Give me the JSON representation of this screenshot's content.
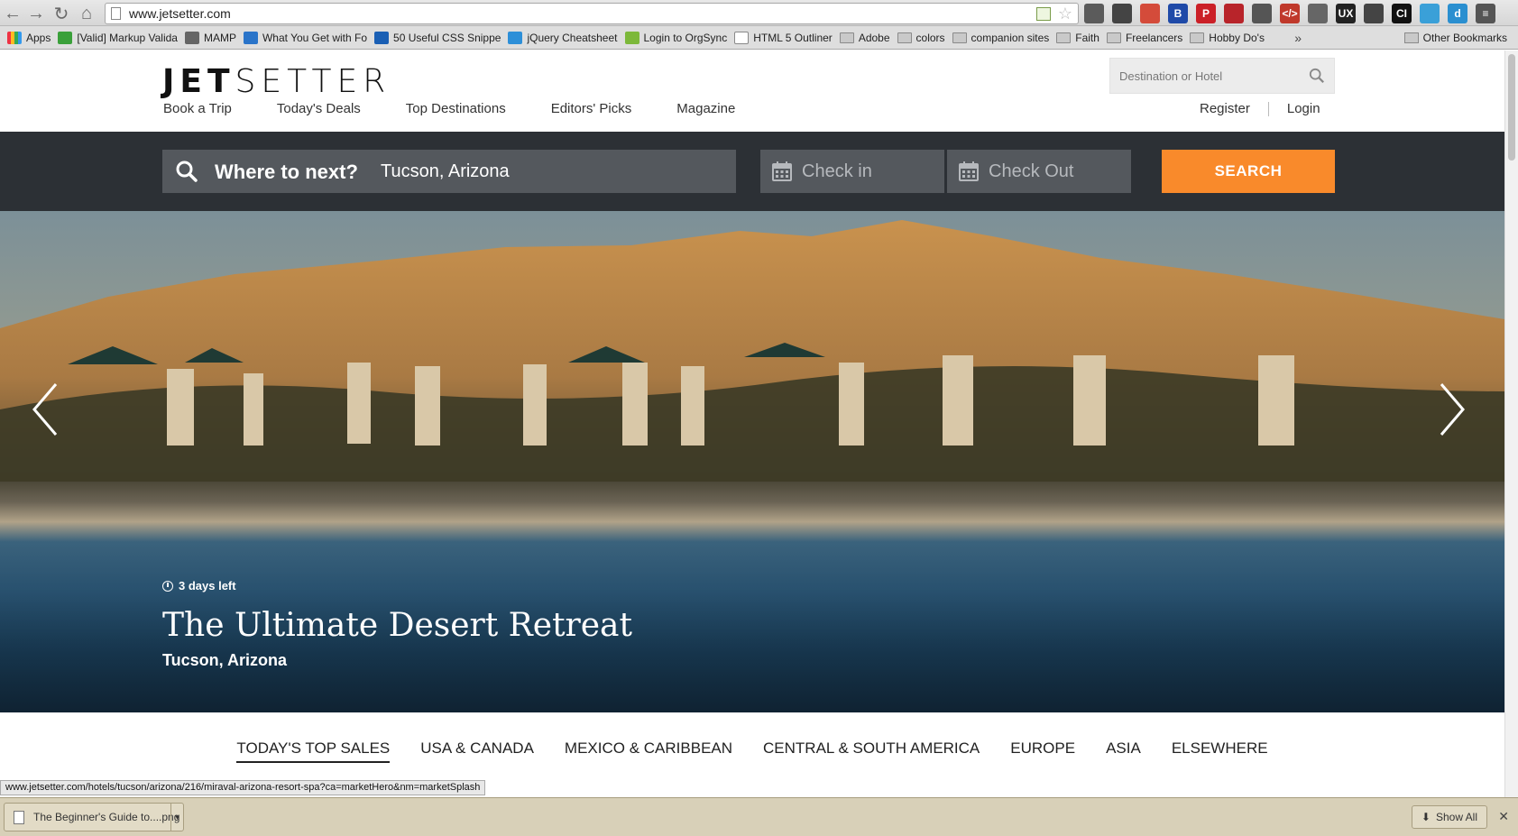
{
  "browser": {
    "url": "www.jetsetter.com",
    "extensions": [
      {
        "icon": "eyedropper-icon",
        "color": "#5b5b5b",
        "text": ""
      },
      {
        "icon": "gear-icon",
        "color": "#444444",
        "text": ""
      },
      {
        "icon": "notes-icon",
        "color": "#d44b3a",
        "text": ""
      },
      {
        "icon": "b-icon",
        "color": "#1f4aa8",
        "text": "B"
      },
      {
        "icon": "pinterest-icon",
        "color": "#cb2027",
        "text": "P"
      },
      {
        "icon": "hat-icon",
        "color": "#b8242a",
        "text": ""
      },
      {
        "icon": "glove-icon",
        "color": "#555555",
        "text": ""
      },
      {
        "icon": "code-icon",
        "color": "#c0392b",
        "text": "</>"
      },
      {
        "icon": "tools-icon",
        "color": "#666666",
        "text": ""
      },
      {
        "icon": "ux-check-icon",
        "color": "#222222",
        "text": "UX"
      },
      {
        "icon": "camera-icon",
        "color": "#444444",
        "text": ""
      },
      {
        "icon": "ci-icon",
        "color": "#111111",
        "text": "CI"
      },
      {
        "icon": "target-icon",
        "color": "#3aa0d8",
        "text": ""
      },
      {
        "icon": "d-icon",
        "color": "#2a8fd0",
        "text": "d"
      },
      {
        "icon": "menu-icon",
        "color": "#555555",
        "text": "≡"
      }
    ]
  },
  "bookmarks": {
    "items": [
      {
        "label": "Apps",
        "icon": "apps-grid-icon"
      },
      {
        "label": "[Valid] Markup Valida",
        "icon": "validator-icon"
      },
      {
        "label": "MAMP",
        "icon": "mamp-icon"
      },
      {
        "label": "What You Get with Fo",
        "icon": "f-icon"
      },
      {
        "label": "50 Useful CSS Snippe",
        "icon": "h-icon"
      },
      {
        "label": "jQuery Cheatsheet",
        "icon": "jquery-icon"
      },
      {
        "label": "Login to OrgSync",
        "icon": "orgsync-icon"
      },
      {
        "label": "HTML 5 Outliner",
        "icon": "page-icon"
      },
      {
        "label": "Adobe",
        "icon": "folder-icon"
      },
      {
        "label": "colors",
        "icon": "folder-icon"
      },
      {
        "label": "companion sites",
        "icon": "folder-icon"
      },
      {
        "label": "Faith",
        "icon": "folder-icon"
      },
      {
        "label": "Freelancers",
        "icon": "folder-icon"
      },
      {
        "label": "Hobby Do's",
        "icon": "folder-icon"
      }
    ],
    "more": "»",
    "other": "Other Bookmarks"
  },
  "site": {
    "logo_bold": "JET",
    "logo_light": "SETTER",
    "nav": [
      "Book a Trip",
      "Today's Deals",
      "Top Destinations",
      "Editors' Picks",
      "Magazine"
    ],
    "search_placeholder": "Destination or Hotel",
    "register": "Register",
    "login": "Login"
  },
  "search_bar": {
    "where_label": "Where to next?",
    "where_value": "Tucson, Arizona",
    "check_in": "Check in",
    "check_out": "Check Out",
    "search_button": "SEARCH",
    "accent": "#f98a2b"
  },
  "hero": {
    "days_left": "3 days left",
    "title": "The Ultimate Desert Retreat",
    "subtitle": "Tucson, Arizona"
  },
  "tabs": [
    "TODAY'S TOP SALES",
    "USA & CANADA",
    "MEXICO & CARIBBEAN",
    "CENTRAL & SOUTH AMERICA",
    "EUROPE",
    "ASIA",
    "ELSEWHERE"
  ],
  "status_url": "www.jetsetter.com/hotels/tucson/arizona/216/miraval-arizona-resort-spa?ca=marketHero&nm=marketSplash",
  "downloads": {
    "file": "The Beginner's Guide to....png",
    "show_all": "Show All"
  }
}
